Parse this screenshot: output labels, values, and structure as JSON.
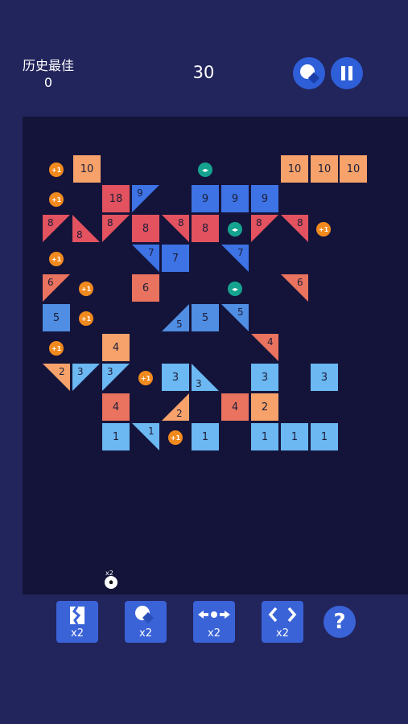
{
  "header": {
    "best_label": "历史最佳",
    "best_value": "0",
    "score": "30"
  },
  "board": {
    "rows": [
      {
        "bricks": [
          {
            "value": "10"
          },
          {
            "value": "10"
          },
          {
            "value": "10"
          },
          {
            "value": "10"
          }
        ]
      },
      {
        "bricks": [
          {
            "value": "18"
          },
          {
            "value": "9"
          },
          {
            "value": "9"
          },
          {
            "value": "9"
          },
          {
            "value": "9"
          }
        ]
      },
      {
        "bricks": [
          {
            "value": "8"
          },
          {
            "value": "8"
          },
          {
            "value": "8"
          },
          {
            "value": "8"
          },
          {
            "value": "8"
          },
          {
            "value": "8"
          },
          {
            "value": "8"
          },
          {
            "value": "8"
          }
        ]
      },
      {
        "bricks": [
          {
            "value": "7"
          },
          {
            "value": "7"
          },
          {
            "value": "7"
          }
        ]
      },
      {
        "bricks": [
          {
            "value": "6"
          },
          {
            "value": "6"
          },
          {
            "value": "6"
          }
        ]
      },
      {
        "bricks": [
          {
            "value": "5"
          },
          {
            "value": "5"
          },
          {
            "value": "5"
          },
          {
            "value": "5"
          }
        ]
      },
      {
        "bricks": [
          {
            "value": "4"
          },
          {
            "value": "4"
          }
        ]
      },
      {
        "bricks": [
          {
            "value": "2"
          },
          {
            "value": "3"
          },
          {
            "value": "3"
          },
          {
            "value": "3"
          },
          {
            "value": "3"
          },
          {
            "value": "3"
          },
          {
            "value": "3"
          }
        ]
      },
      {
        "bricks": [
          {
            "value": "4"
          },
          {
            "value": "2"
          },
          {
            "value": "4"
          },
          {
            "value": "2"
          }
        ]
      },
      {
        "bricks": [
          {
            "value": "1"
          },
          {
            "value": "1"
          },
          {
            "value": "1"
          },
          {
            "value": "1"
          },
          {
            "value": "1"
          },
          {
            "value": "1"
          }
        ]
      }
    ],
    "plus_one_label": "+1",
    "ball_multiplier": "x2"
  },
  "tools": [
    {
      "icon": "split-brick-icon",
      "count": "x2"
    },
    {
      "icon": "ball-icon",
      "count": "x2"
    },
    {
      "icon": "spread-icon",
      "count": "x2"
    },
    {
      "icon": "expand-icon",
      "count": "x2"
    }
  ],
  "help_label": "?",
  "colors": {
    "orange_light": "#f6a26a",
    "coral": "#e9735e",
    "red": "#e2525f",
    "blue_dark": "#3d73e4",
    "blue_mid": "#4f8ee3",
    "blue_light": "#6bb8f2",
    "plus": "#f18a1e",
    "split": "#15a38f"
  }
}
